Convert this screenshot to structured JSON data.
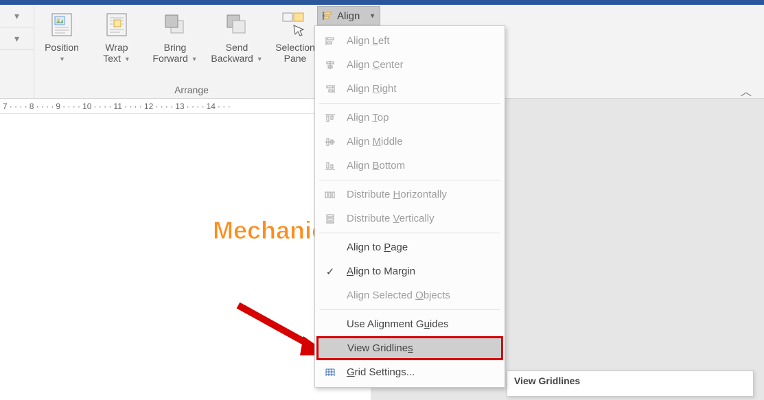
{
  "ribbon": {
    "group_label": "Arrange",
    "buttons": {
      "position": "Position",
      "wrap": "Wrap\nText",
      "bring": "Bring\nForward",
      "send": "Send\nBackward",
      "selection": "Selection\nPane"
    },
    "align_button": "Align"
  },
  "ruler": {
    "marks": [
      "7",
      "8",
      "9",
      "10",
      "11",
      "12",
      "13",
      "14"
    ]
  },
  "menu": {
    "align_left": "Align Left",
    "align_center": "Align Center",
    "align_right": "Align Right",
    "align_top": "Align Top",
    "align_middle": "Align Middle",
    "align_bottom": "Align Bottom",
    "dist_h": "Distribute Horizontally",
    "dist_v": "Distribute Vertically",
    "align_page": "Align to Page",
    "align_margin": "Align to Margin",
    "align_selected": "Align Selected Objects",
    "use_guides": "Use Alignment Guides",
    "view_gridlines": "View Gridlines",
    "grid_settings": "Grid Settings..."
  },
  "tooltip": "View Gridlines",
  "watermark": "Mechanicalengblog.com"
}
